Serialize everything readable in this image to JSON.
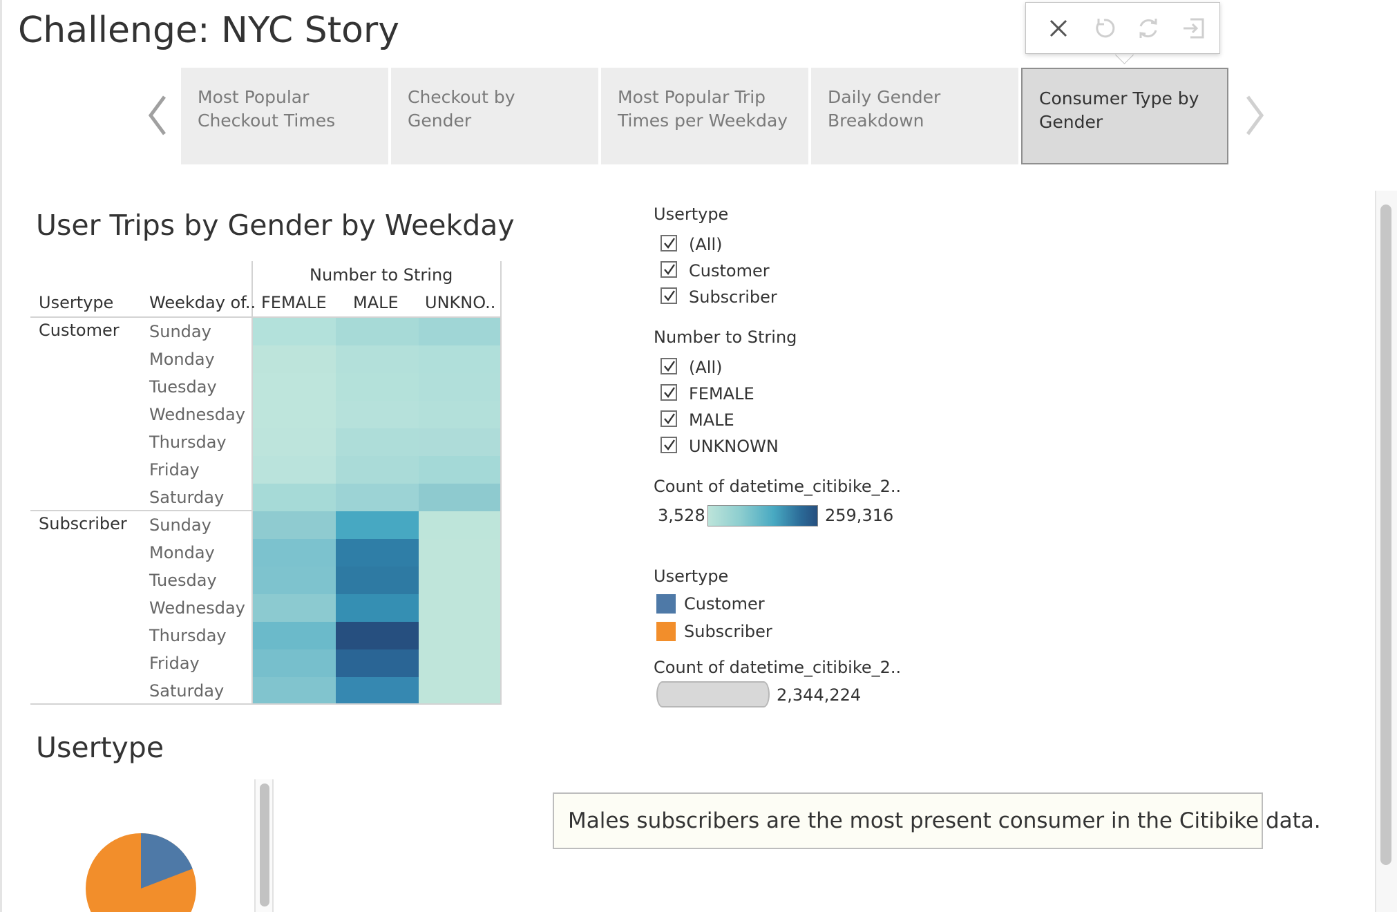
{
  "story": {
    "title": "Challenge: NYC Story",
    "points": [
      "Most Popular Checkout Times",
      "Checkout by Gender",
      "Most Popular Trip Times per Weekday",
      "Daily Gender Breakdown",
      "Consumer Type by Gender"
    ],
    "active_point": 4
  },
  "toolbar": {
    "icons": [
      "close-icon",
      "undo-icon",
      "refresh-icon",
      "export-icon"
    ]
  },
  "heatmap": {
    "title": "User Trips by Gender by Weekday",
    "column_header": "Number to String",
    "row_header_1": "Usertype",
    "row_header_2": "Weekday of..",
    "columns": [
      "FEMALE",
      "MALE",
      "UNKNO.."
    ],
    "groups": [
      {
        "label": "Customer",
        "days": [
          "Sunday",
          "Monday",
          "Tuesday",
          "Wednesday",
          "Thursday",
          "Friday",
          "Saturday"
        ]
      },
      {
        "label": "Subscriber",
        "days": [
          "Sunday",
          "Monday",
          "Tuesday",
          "Wednesday",
          "Thursday",
          "Friday",
          "Saturday"
        ]
      }
    ],
    "cell_colors": [
      [
        "#b3e1db",
        "#a7dad7",
        "#a0d6d6"
      ],
      [
        "#bde4db",
        "#b3e0da",
        "#b0dfda"
      ],
      [
        "#bee5dc",
        "#b4e1da",
        "#b1dfda"
      ],
      [
        "#bee5dc",
        "#b6e1db",
        "#b3e0da"
      ],
      [
        "#bde4dc",
        "#aeddd9",
        "#aedcd9"
      ],
      [
        "#bae3dc",
        "#aadbd8",
        "#a4d9d7"
      ],
      [
        "#a6dad7",
        "#9cd3d5",
        "#8ecacf"
      ],
      [
        "#8fcbd0",
        "#47a8c2",
        "#bee5da"
      ],
      [
        "#7cc2ce",
        "#2f7ea7",
        "#bfe5da"
      ],
      [
        "#7ec3ce",
        "#2e7aa3",
        "#bfe5da"
      ],
      [
        "#8ccad0",
        "#358fb3",
        "#bfe5da"
      ],
      [
        "#6bbaca",
        "#264f7f",
        "#bfe5da"
      ],
      [
        "#77bfcc",
        "#2a6595",
        "#bfe5da"
      ],
      [
        "#81c4ce",
        "#3688b1",
        "#bfe5da"
      ]
    ]
  },
  "filters": {
    "usertype": {
      "title": "Usertype",
      "options": [
        "(All)",
        "Customer",
        "Subscriber"
      ]
    },
    "gender": {
      "title": "Number to String",
      "options": [
        "(All)",
        "FEMALE",
        "MALE",
        "UNKNOWN"
      ]
    }
  },
  "legends": {
    "color_title": "Count of datetime_citibike_2..",
    "color_min": "3,528",
    "color_max": "259,316",
    "color_scale": [
      "#bde4da",
      "#264f7f"
    ],
    "usertype_title": "Usertype",
    "usertype_items": [
      {
        "label": "Customer",
        "color": "#4e79a7"
      },
      {
        "label": "Subscriber",
        "color": "#f28e2b"
      }
    ],
    "size_title": "Count of datetime_citibike_2..",
    "size_value": "2,344,224"
  },
  "pie": {
    "title": "Usertype"
  },
  "caption": "Males subscribers are the most present consumer in the Citibike data."
}
